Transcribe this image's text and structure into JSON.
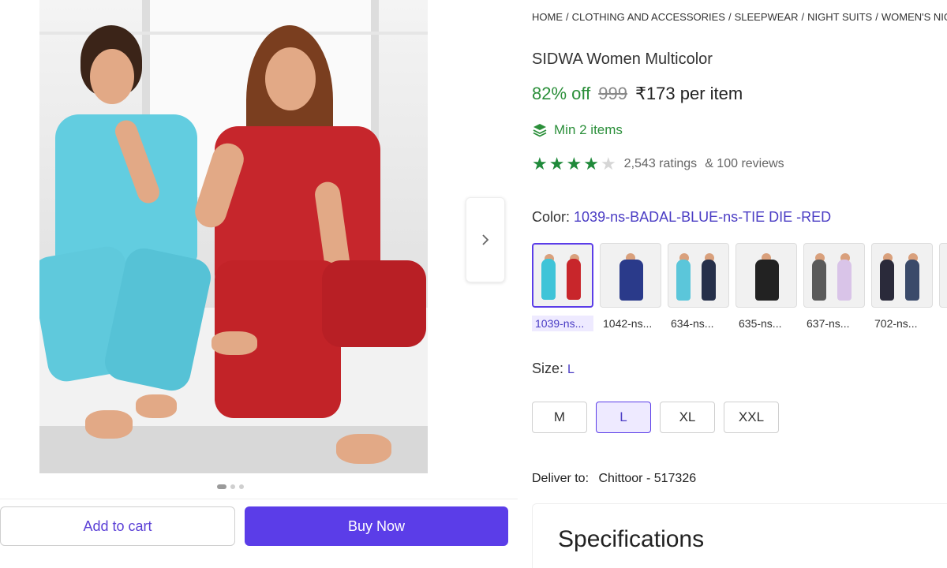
{
  "gallery": {
    "next_icon": "chevron-right-icon",
    "dots_total": 3,
    "dots_active": 1
  },
  "actions": {
    "add_to_cart": "Add to cart",
    "buy_now": "Buy Now"
  },
  "breadcrumb": [
    "HOME",
    "CLOTHING AND ACCESSORIES",
    "SLEEPWEAR",
    "NIGHT SUITS",
    "WOMEN'S NIGHT S"
  ],
  "product": {
    "title": "SIDWA Women Multicolor",
    "discount": "82% off",
    "mrp": "999",
    "price": "₹173 per item",
    "min_items": "Min 2 items",
    "rating_stars": 4,
    "ratings": "2,543 ratings",
    "reviews": "& 100 reviews"
  },
  "color": {
    "label": "Color:",
    "selected": "1039-ns-BADAL-BLUE-ns-TIE DIE -RED",
    "options": [
      {
        "name": "1039-ns...",
        "c1": "#3fc4d8",
        "c2": "#c8262b"
      },
      {
        "name": "1042-ns...",
        "c1": "#2a3a8a",
        "c2": "#2a3a8a"
      },
      {
        "name": "634-ns...",
        "c1": "#5bc6da",
        "c2": "#26304a"
      },
      {
        "name": "635-ns...",
        "c1": "#222222",
        "c2": "#222222"
      },
      {
        "name": "637-ns...",
        "c1": "#5a5a5a",
        "c2": "#d9c4e8"
      },
      {
        "name": "702-ns...",
        "c1": "#2a2a3a",
        "c2": "#3a4a6a"
      }
    ]
  },
  "size": {
    "label": "Size:",
    "selected": "L",
    "options": [
      "M",
      "L",
      "XL",
      "XXL"
    ]
  },
  "delivery": {
    "label": "Deliver to:",
    "location": "Chittoor - 517326"
  },
  "specs": {
    "heading": "Specifications"
  },
  "colors": {
    "accent": "#5b3de8",
    "discount_green": "#2b8f3a",
    "star_green": "#1f8a3a"
  }
}
